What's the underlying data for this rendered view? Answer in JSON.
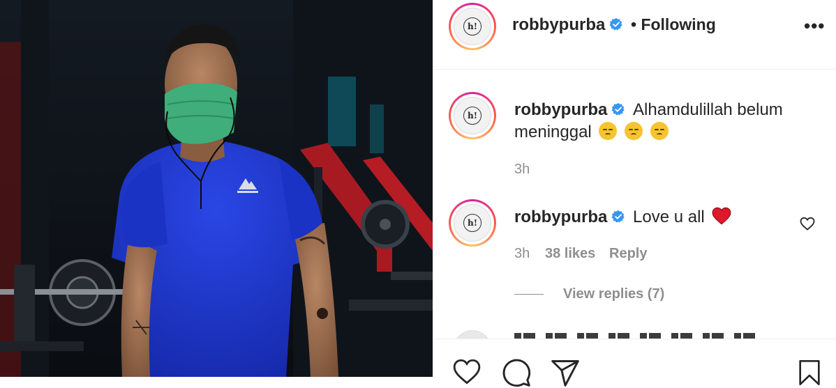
{
  "header": {
    "username": "robbypurba",
    "follow_status": "• Following",
    "more_label": "•••",
    "avatar_logo": "h!"
  },
  "comments": [
    {
      "username": "robbypurba",
      "text_line1": "Alhamdulillah belum",
      "text_line2": "meninggal",
      "emoji": [
        "pensive-face-emoji",
        "pensive-face-emoji",
        "pensive-face-emoji"
      ],
      "time": "3h"
    },
    {
      "username": "robbypurba",
      "text": "Love u all",
      "emoji": "red-heart-emoji",
      "time": "3h",
      "likes": "38 likes",
      "reply_label": "Reply",
      "view_replies": "View replies (7)"
    }
  ],
  "icons": {
    "verified": "verified-badge-icon",
    "like": "heart-icon",
    "comment": "comment-icon",
    "share": "share-icon",
    "save": "bookmark-icon"
  },
  "colors": {
    "verified_blue": "#3897f0",
    "text_primary": "#262626",
    "text_secondary": "#8e8e8e",
    "shirt_blue": "#1e35c9",
    "mask_green": "#3fae7a"
  }
}
